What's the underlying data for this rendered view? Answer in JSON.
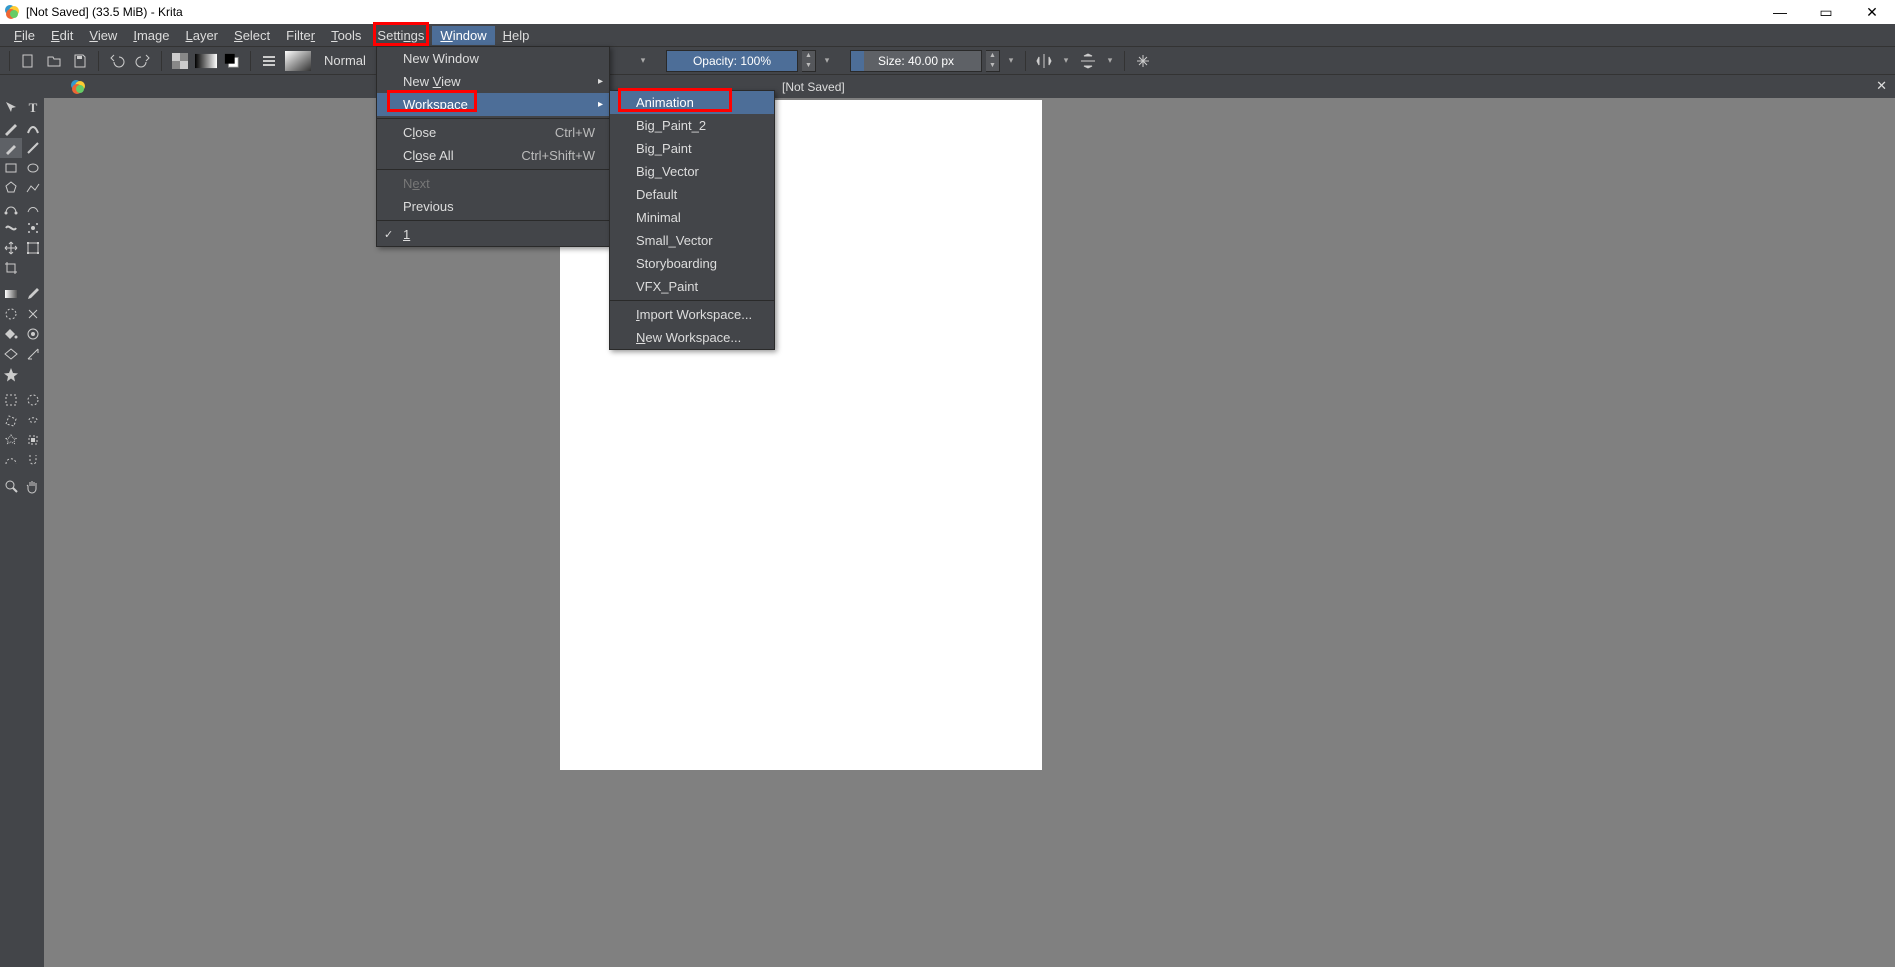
{
  "titlebar": {
    "text": "[Not Saved]  (33.5 MiB)  - Krita"
  },
  "menubar": {
    "items": [
      {
        "label": "File",
        "accel": "F"
      },
      {
        "label": "Edit",
        "accel": "E"
      },
      {
        "label": "View",
        "accel": "V"
      },
      {
        "label": "Image",
        "accel": "I"
      },
      {
        "label": "Layer",
        "accel": "L"
      },
      {
        "label": "Select",
        "accel": "S"
      },
      {
        "label": "Filter",
        "accel": "r"
      },
      {
        "label": "Tools",
        "accel": "T"
      },
      {
        "label": "Settings",
        "accel": "n"
      },
      {
        "label": "Window",
        "accel": "W"
      },
      {
        "label": "Help",
        "accel": "H"
      }
    ]
  },
  "toolbar": {
    "blend_mode": "Normal",
    "opacity_label": "Opacity: 100%",
    "size_label": "Size: 40.00 px"
  },
  "doctab": {
    "label": "[Not Saved]"
  },
  "window_menu": {
    "new_window": "New Window",
    "new_view": "New View",
    "workspace": "Workspace",
    "close": "Close",
    "close_sc": "Ctrl+W",
    "close_all": "Close All",
    "close_all_sc": "Ctrl+Shift+W",
    "next": "Next",
    "previous": "Previous",
    "doc1": "1"
  },
  "workspace_menu": {
    "items": [
      "Animation",
      "Big_Paint_2",
      "Big_Paint",
      "Big_Vector",
      "Default",
      "Minimal",
      "Small_Vector",
      "Storyboarding",
      "VFX_Paint"
    ],
    "import": "Import Workspace...",
    "new": "New Workspace..."
  }
}
